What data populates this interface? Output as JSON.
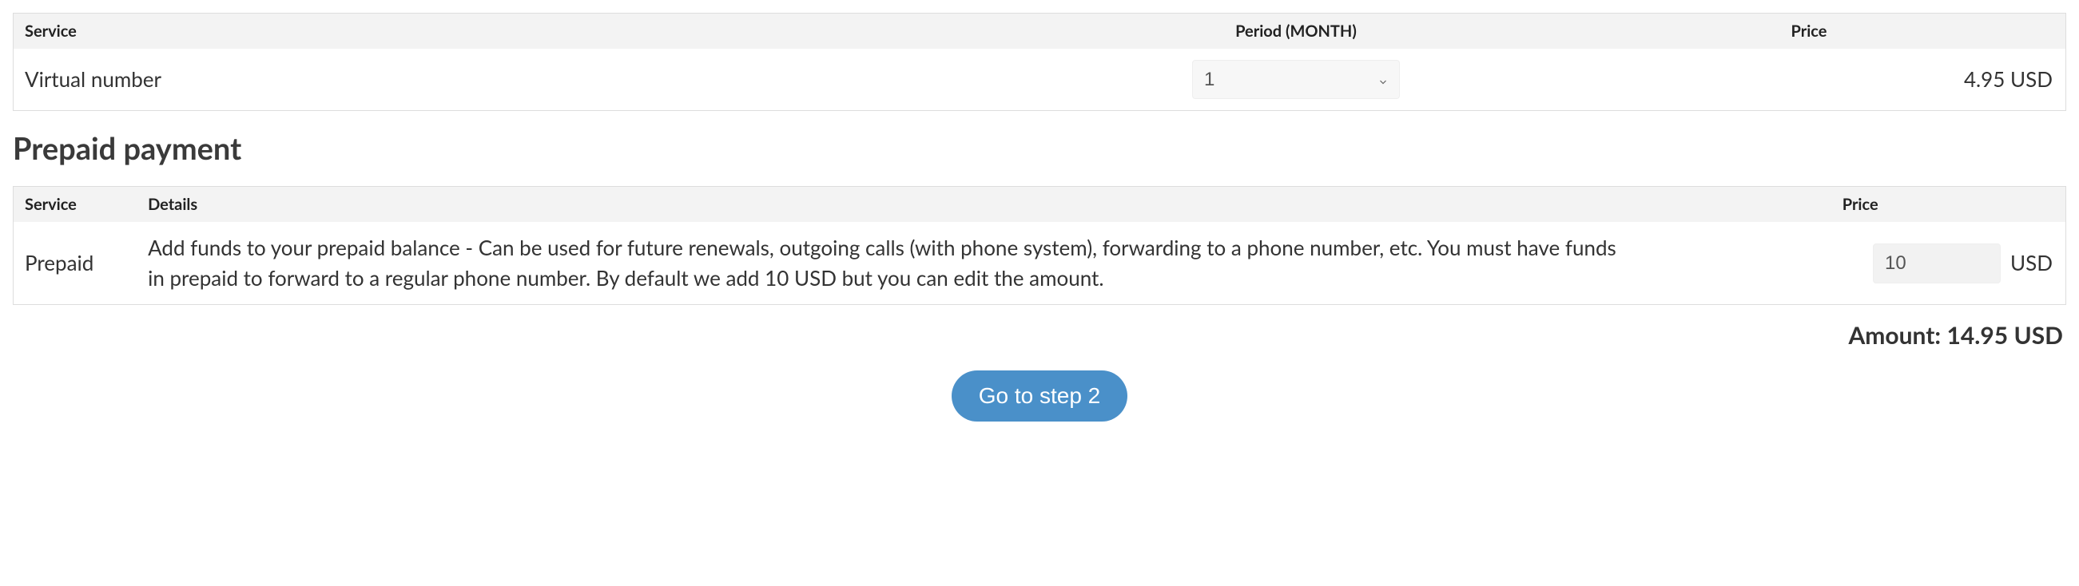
{
  "service_table": {
    "headers": {
      "service": "Service",
      "period": "Period (MONTH)",
      "price": "Price"
    },
    "row": {
      "service": "Virtual number",
      "period_value": "1",
      "price": "4.95 USD"
    }
  },
  "section_title": "Prepaid payment",
  "prepaid_table": {
    "headers": {
      "service": "Service",
      "details": "Details",
      "price": "Price"
    },
    "row": {
      "service": "Prepaid",
      "details": "Add funds to your prepaid balance - Can be used for future renewals, outgoing calls (with phone system), forwarding to a phone number, etc. You must have funds in prepaid to forward to a regular phone number. By default we add 10 USD but you can edit the amount.",
      "amount_value": "10",
      "currency": "USD"
    }
  },
  "total": {
    "label": "Amount:",
    "value": "14.95 USD"
  },
  "button": {
    "label": "Go to step 2"
  }
}
